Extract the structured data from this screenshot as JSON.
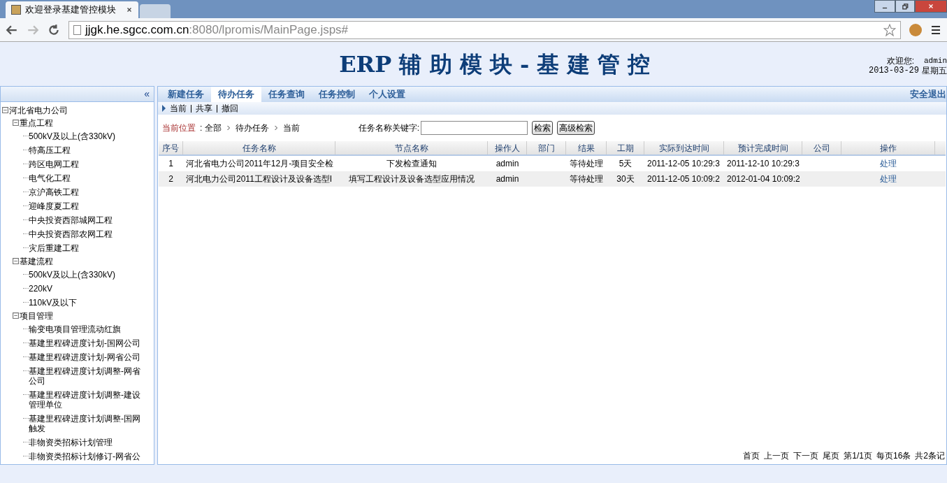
{
  "browser": {
    "tabs": [
      {
        "title": "欢迎登录基建管控模块",
        "selected": true
      },
      {
        "selected": false
      }
    ],
    "address": {
      "host": "jjgk.he.sgcc.com.cn",
      "rest": ":8080/lpromis/MainPage.jsps#"
    }
  },
  "header": {
    "title": "ERP 辅 助 模 块 - 基 建 管 控",
    "welcome_label": "欢迎您:",
    "user": "admin",
    "date": "2013-03-29",
    "weekday": "星期五"
  },
  "sidebar": {
    "collapse": "«",
    "tree": [
      {
        "label": "河北省电力公司",
        "expanded": true,
        "children": [
          {
            "label": "重点工程",
            "expanded": true,
            "children": [
              {
                "label": "500kV及以上(含330kV)"
              },
              {
                "label": "特高压工程"
              },
              {
                "label": "跨区电网工程"
              },
              {
                "label": "电气化工程"
              },
              {
                "label": "京沪高铁工程"
              },
              {
                "label": "迎峰度夏工程"
              },
              {
                "label": "中央投资西部城网工程"
              },
              {
                "label": "中央投资西部农网工程"
              },
              {
                "label": "灾后重建工程"
              }
            ]
          },
          {
            "label": "基建流程",
            "expanded": true,
            "children": [
              {
                "label": "500kV及以上(含330kV)"
              },
              {
                "label": "220kV"
              },
              {
                "label": "110kV及以下"
              }
            ]
          },
          {
            "label": "项目管理",
            "expanded": true,
            "children": [
              {
                "label": "输变电项目管理流动红旗"
              },
              {
                "label": "基建里程碑进度计划-国网公司"
              },
              {
                "label": "基建里程碑进度计划-网省公司"
              },
              {
                "label": "基建里程碑进度计划调整-网省公司"
              },
              {
                "label": "基建里程碑进度计划调整-建设管理单位"
              },
              {
                "label": "基建里程碑进度计划调整-国网触发"
              },
              {
                "label": "非物资类招标计划管理"
              },
              {
                "label": "非物资类招标计划修订-网省公"
              }
            ]
          }
        ]
      }
    ]
  },
  "nav": {
    "tabs": [
      {
        "label": "新建任务",
        "selected": false
      },
      {
        "label": "待办任务",
        "selected": true
      },
      {
        "label": "任务查询",
        "selected": false
      },
      {
        "label": "任务控制",
        "selected": false
      },
      {
        "label": "个人设置",
        "selected": false
      }
    ],
    "logout": "安全退出"
  },
  "subnav": [
    "当前",
    "共享",
    "撤回"
  ],
  "breadcrumb": {
    "label": "当前位置",
    "path": [
      ": 全部",
      "待办任务",
      "当前"
    ]
  },
  "search": {
    "label": "任务名称关键字:",
    "buttons": [
      "检索",
      "高级检索"
    ]
  },
  "table": {
    "columns": [
      "序号",
      "任务名称",
      "节点名称",
      "操作人",
      "部门",
      "结果",
      "工期",
      "实际到达时间",
      "预计完成时间",
      "公司",
      "操作"
    ],
    "rows": [
      [
        "1",
        "河北省电力公司2011年12月-项目安全检",
        "下发检查通知",
        "admin",
        "",
        "等待处理",
        "5天",
        "2011-12-05 10:29:3",
        "2011-12-10 10:29:3",
        "",
        "处理"
      ],
      [
        "2",
        "河北电力公司2011工程设计及设备选型I",
        "填写工程设计及设备选型应用情况",
        "admin",
        "",
        "等待处理",
        "30天",
        "2011-12-05 10:09:2",
        "2012-01-04 10:09:2",
        "",
        "处理"
      ]
    ]
  },
  "pagination": [
    "首页",
    "上一页",
    "下一页",
    "尾页",
    "第1/1页",
    "每页16条",
    "共2条记"
  ]
}
